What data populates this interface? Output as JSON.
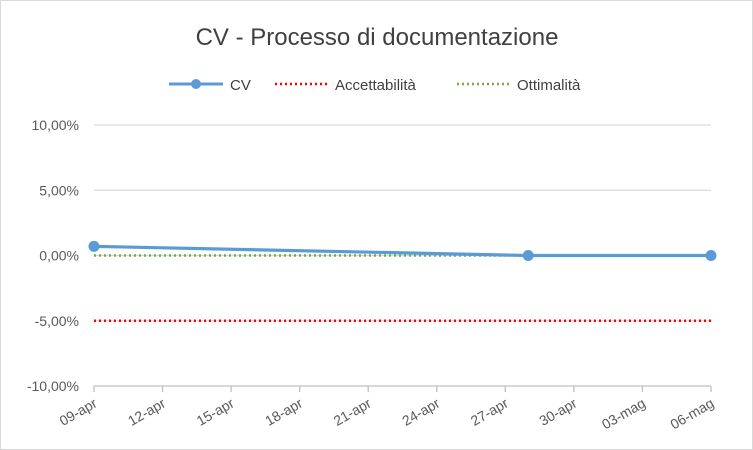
{
  "chart_data": {
    "type": "line",
    "title": "CV - Processo di documentazione",
    "xlabel": "",
    "ylabel": "",
    "x_tick_labels": [
      "09-apr",
      "12-apr",
      "15-apr",
      "18-apr",
      "21-apr",
      "24-apr",
      "27-apr",
      "30-apr",
      "03-mag",
      "06-mag"
    ],
    "x_tick_dates": [
      "2020-04-09",
      "2020-04-12",
      "2020-04-15",
      "2020-04-18",
      "2020-04-21",
      "2020-04-24",
      "2020-04-27",
      "2020-04-30",
      "2020-05-03",
      "2020-05-06"
    ],
    "y_tick_labels": [
      "-10,00%",
      "-5,00%",
      "0,00%",
      "5,00%",
      "10,00%"
    ],
    "ylim": [
      -10,
      10
    ],
    "y_unit": "%",
    "grid": true,
    "legend_position": "top",
    "series": [
      {
        "name": "CV",
        "style": "solid-marker",
        "color": "#5b9bd5",
        "points": [
          {
            "x": "2020-04-09",
            "y": 0.7
          },
          {
            "x": "2020-04-28",
            "y": 0.0
          },
          {
            "x": "2020-05-06",
            "y": 0.0
          }
        ]
      },
      {
        "name": "Accettabilità",
        "style": "dotted",
        "color": "#ff0000",
        "points": [
          {
            "x": "2020-04-09",
            "y": -5.0
          },
          {
            "x": "2020-05-06",
            "y": -5.0
          }
        ]
      },
      {
        "name": "Ottimalità",
        "style": "dotted",
        "color": "#70ad47",
        "points": [
          {
            "x": "2020-04-09",
            "y": 0.0
          },
          {
            "x": "2020-05-06",
            "y": 0.0
          }
        ]
      }
    ]
  }
}
